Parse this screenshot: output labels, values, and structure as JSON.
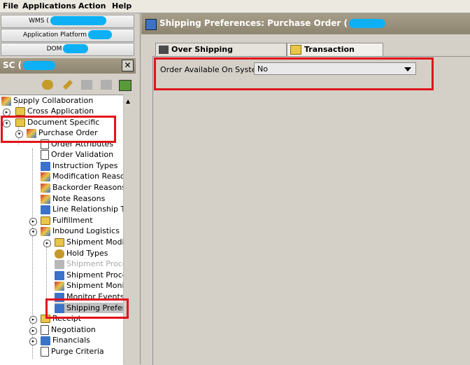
{
  "menubar": {
    "items": [
      {
        "label": "File",
        "key": "F"
      },
      {
        "label": "Applications",
        "key": "A"
      },
      {
        "label": "Action",
        "key": "A"
      },
      {
        "label": "Help",
        "key": "H"
      }
    ]
  },
  "apps": [
    {
      "label": "WMS ("
    },
    {
      "label": "Application Platform"
    },
    {
      "label": "DOM"
    }
  ],
  "panel": {
    "title": "SC ("
  },
  "tree": {
    "root": "Supply Collaboration",
    "items": [
      {
        "label": "Cross Application"
      },
      {
        "label": "Document Specific"
      },
      {
        "label": "Purchase Order"
      },
      {
        "label": "Order Attributes"
      },
      {
        "label": "Order Validation"
      },
      {
        "label": "Instruction Types"
      },
      {
        "label": "Modification Reasons"
      },
      {
        "label": "Backorder Reasons"
      },
      {
        "label": "Note Reasons"
      },
      {
        "label": "Line Relationship Type"
      },
      {
        "label": "Fulfillment"
      },
      {
        "label": "Inbound Logistics"
      },
      {
        "label": "Shipment Modifica"
      },
      {
        "label": "Hold Types"
      },
      {
        "label": "Shipment Process"
      },
      {
        "label": "Shipment Process"
      },
      {
        "label": "Shipment Monitor"
      },
      {
        "label": "Monitor Events"
      },
      {
        "label": "Shipping Preferer"
      },
      {
        "label": "Receipt"
      },
      {
        "label": "Negotiation"
      },
      {
        "label": "Financials"
      },
      {
        "label": "Purge Criteria"
      }
    ]
  },
  "main": {
    "title": "Shipping Preferences: Purchase Order (",
    "tabs": [
      {
        "label": "Over Shipping Preferences"
      },
      {
        "label": "Transaction Rules"
      }
    ],
    "field": {
      "label": "Order Available On System",
      "value": "No"
    }
  },
  "colors": {
    "highlight": "#e0131a",
    "redaction": "#0db0f5",
    "header": "#8d8570"
  }
}
